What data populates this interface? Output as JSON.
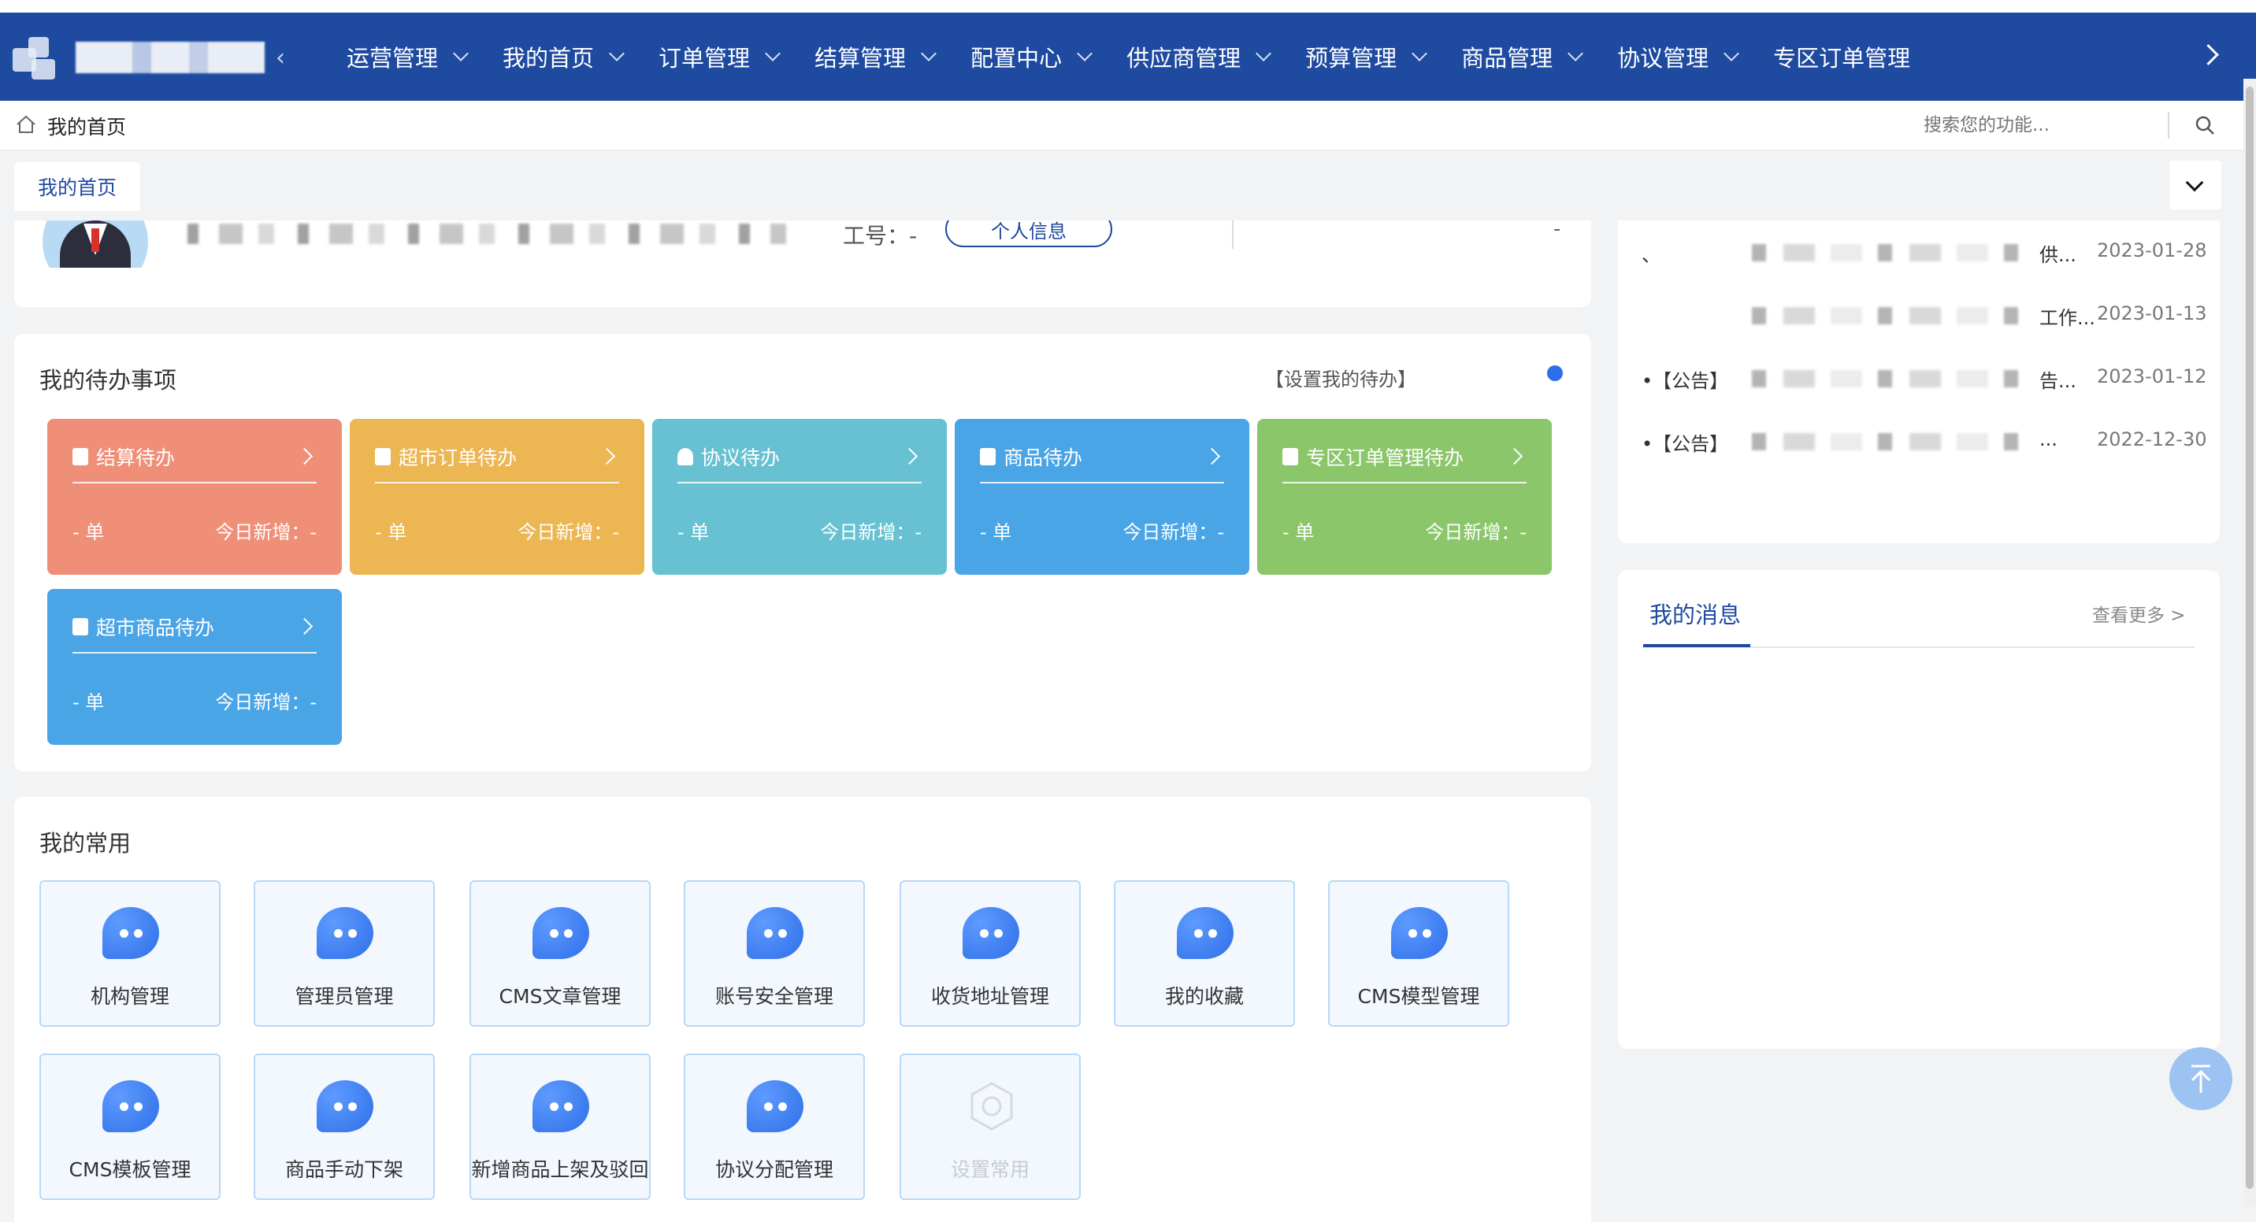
{
  "header": {
    "nav": [
      "运营管理",
      "我的首页",
      "订单管理",
      "结算管理",
      "配置中心",
      "供应商管理",
      "预算管理",
      "商品管理",
      "协议管理",
      "专区订单管理"
    ]
  },
  "breadcrumb": {
    "label": "我的首页",
    "search_placeholder": "搜索您的功能..."
  },
  "tabs": {
    "active": "我的首页"
  },
  "profile": {
    "empno": "工号：-",
    "info_button": "个人信息",
    "right_value": "-"
  },
  "todo": {
    "title": "我的待办事项",
    "setting": "【设置我的待办】",
    "tiles": [
      {
        "name": "结算待办",
        "unit": "- 单",
        "new": "今日新增：-",
        "color": "#f08f78"
      },
      {
        "name": "超市订单待办",
        "unit": "- 单",
        "new": "今日新增：-",
        "color": "#ecb653"
      },
      {
        "name": "协议待办",
        "unit": "- 单",
        "new": "今日新增：-",
        "color": "#67c1d2"
      },
      {
        "name": "商品待办",
        "unit": "- 单",
        "new": "今日新增：-",
        "color": "#4aa5e6"
      },
      {
        "name": "专区订单管理待办",
        "unit": "- 单",
        "new": "今日新增：-",
        "color": "#8cc66b"
      },
      {
        "name": "超市商品待办",
        "unit": "- 单",
        "new": "今日新增：-",
        "color": "#4aa5e6"
      }
    ]
  },
  "common": {
    "title": "我的常用",
    "items": [
      "机构管理",
      "管理员管理",
      "CMS文章管理",
      "账号安全管理",
      "收货地址管理",
      "我的收藏",
      "CMS模型管理",
      "CMS模板管理",
      "商品手动下架",
      "新增商品上架及驳回",
      "协议分配管理",
      "设置常用"
    ]
  },
  "notices": [
    {
      "prefix": "、",
      "suffix": "供...",
      "date": "2023-01-28"
    },
    {
      "prefix": "",
      "suffix": "工作...",
      "date": "2023-01-13"
    },
    {
      "prefix": "•【公告】",
      "suffix": "告...",
      "date": "2023-01-12"
    },
    {
      "prefix": "•【公告】",
      "suffix": "...",
      "date": "2022-12-30"
    }
  ],
  "messages": {
    "title": "我的消息",
    "more": "查看更多 >"
  }
}
